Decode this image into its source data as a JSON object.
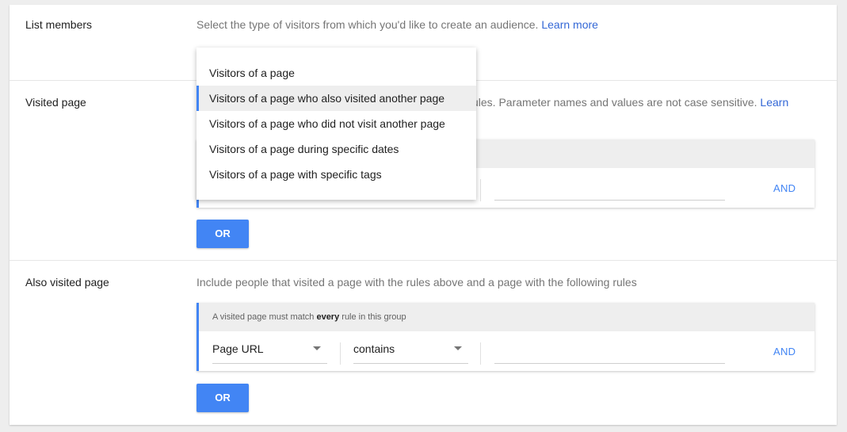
{
  "sections": {
    "list_members": {
      "label": "List members",
      "help_text": "Select the type of visitors from which you'd like to create an audience.",
      "learn_more": "Learn more"
    },
    "visited_page": {
      "label": "Visited page",
      "help_text_partial": "ules. Parameter names and values are not case sensitive.",
      "learn_more": "Learn",
      "and_label": "AND",
      "or_label": "OR"
    },
    "also_visited_page": {
      "label": "Also visited page",
      "help_text": "Include people that visited a page with the rules above and a page with the following rules",
      "group_header_prefix": "A visited page must match ",
      "group_header_bold": "every",
      "group_header_suffix": " rule in this group",
      "field_select": "Page URL",
      "operator_select": "contains",
      "value": "",
      "and_label": "AND",
      "or_label": "OR"
    }
  },
  "dropdown": {
    "options": [
      "Visitors of a page",
      "Visitors of a page who also visited another page",
      "Visitors of a page who did not visit another page",
      "Visitors of a page during specific dates",
      "Visitors of a page with specific tags"
    ],
    "selected_index": 1
  },
  "colors": {
    "accent": "#4285f4",
    "link": "#3367d6"
  }
}
